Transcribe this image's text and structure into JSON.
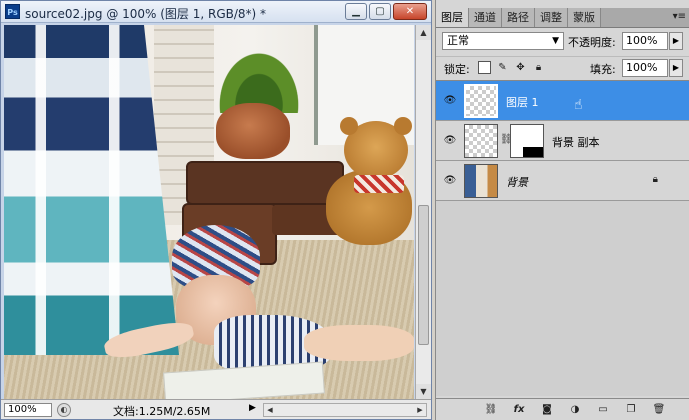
{
  "document": {
    "app_icon_text": "Ps",
    "title": "source02.jpg @ 100% (图层 1, RGB/8*) *",
    "minimize_label": "▁",
    "maximize_label": "▢",
    "close_label": "✕",
    "zoom": "100%",
    "doc_info": "文档:1.25M/2.65M"
  },
  "layers_panel": {
    "tabs": [
      {
        "label": "图层",
        "active": true
      },
      {
        "label": "通道",
        "active": false
      },
      {
        "label": "路径",
        "active": false
      },
      {
        "label": "调整",
        "active": false
      },
      {
        "label": "蒙版",
        "active": false
      }
    ],
    "menu_icon": "panel-menu-icon",
    "blend_mode": "正常",
    "opacity_label": "不透明度:",
    "opacity": "100%",
    "lock_label": "锁定:",
    "fill_label": "填充:",
    "fill": "100%",
    "layers": [
      {
        "name": "图层 1",
        "selected": true,
        "visible": true
      },
      {
        "name": "背景 副本",
        "selected": false,
        "visible": true
      },
      {
        "name": "背景",
        "selected": false,
        "visible": true,
        "locked": true
      }
    ]
  },
  "colors": {
    "selection": "#3d8ee6",
    "panel_bg": "#d6d6d6",
    "title_bar": "#d6e1f0"
  },
  "icons": [
    "photoshop-icon",
    "eye-icon",
    "lock-icon",
    "link-icon",
    "mask-icon",
    "fx-icon",
    "adjustment-icon",
    "folder-icon",
    "new-layer-icon",
    "trash-icon",
    "brush-icon",
    "move-icon",
    "transparency-lock-icon"
  ]
}
